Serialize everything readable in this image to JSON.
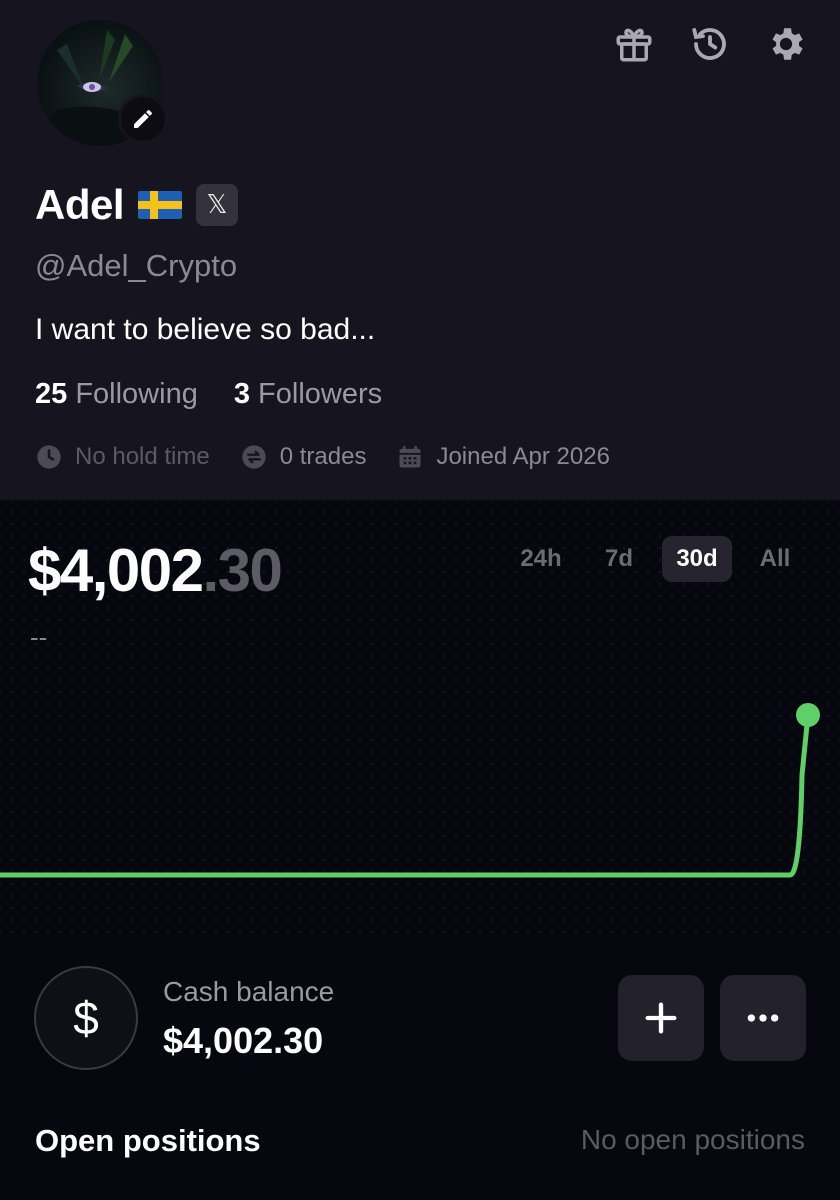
{
  "profile": {
    "display_name": "Adel",
    "flag": "sweden-flag",
    "social_badge": "𝕏",
    "handle": "@Adel_Crypto",
    "bio": "I want to believe so bad...",
    "following_count": "25",
    "following_label": "Following",
    "followers_count": "3",
    "followers_label": "Followers",
    "hold_time": "No hold time",
    "trades": "0 trades",
    "joined": "Joined Apr 2026"
  },
  "header_icons": [
    "gift-icon",
    "history-icon",
    "settings-icon"
  ],
  "portfolio": {
    "value_main": "$4,002",
    "value_cents": ".30",
    "change": "--",
    "ranges": [
      "24h",
      "7d",
      "30d",
      "All"
    ],
    "active_range": "30d"
  },
  "chart_data": {
    "type": "line",
    "series": [
      {
        "values": [
          4000,
          4000,
          4000,
          4000,
          4000,
          4000,
          4000,
          4000,
          4000,
          4000,
          4000,
          4000,
          4000,
          4000,
          4000,
          4000,
          4000,
          4000,
          4000,
          4000,
          4000,
          4000,
          4000,
          4000,
          4000,
          4000,
          4000,
          4000,
          4000,
          4002.3
        ]
      }
    ],
    "color": "#5fd068"
  },
  "cash": {
    "icon_symbol": "$",
    "label": "Cash balance",
    "value": "$4,002.30"
  },
  "positions": {
    "title": "Open positions",
    "empty_text": "No open positions"
  },
  "colors": {
    "accent_green": "#5fd068",
    "panel": "#16151f",
    "background": "#07070f"
  }
}
